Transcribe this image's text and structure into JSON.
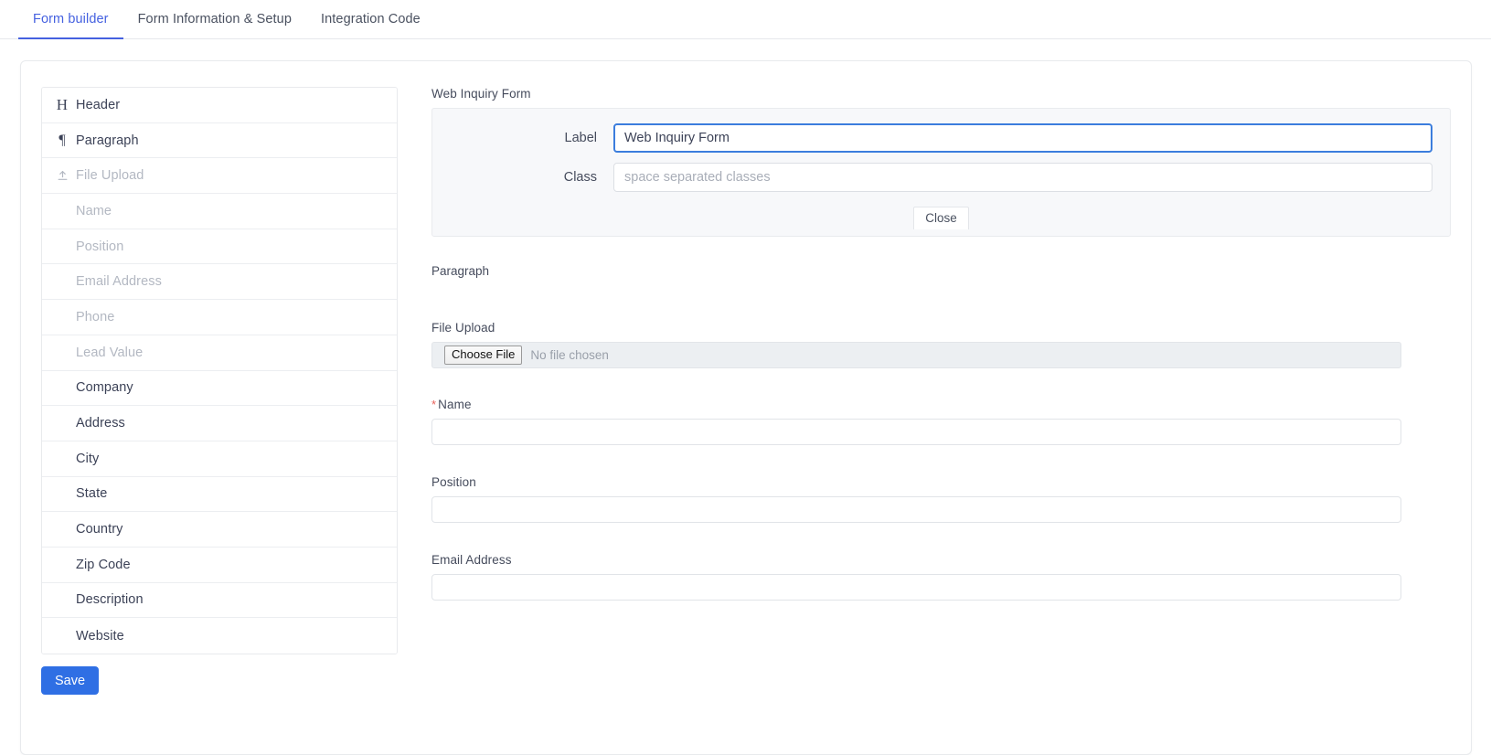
{
  "tabs": [
    {
      "label": "Form builder",
      "active": true
    },
    {
      "label": "Form Information & Setup",
      "active": false
    },
    {
      "label": "Integration Code",
      "active": false
    }
  ],
  "palette": {
    "items": [
      {
        "label": "Header",
        "icon": "heading-icon",
        "disabled": false
      },
      {
        "label": "Paragraph",
        "icon": "paragraph-icon",
        "disabled": false
      },
      {
        "label": "File Upload",
        "icon": "file-upload-icon",
        "disabled": true
      },
      {
        "label": "Name",
        "icon": "",
        "disabled": true
      },
      {
        "label": "Position",
        "icon": "",
        "disabled": true
      },
      {
        "label": "Email Address",
        "icon": "",
        "disabled": true
      },
      {
        "label": "Phone",
        "icon": "",
        "disabled": true
      },
      {
        "label": "Lead Value",
        "icon": "",
        "disabled": true
      },
      {
        "label": "Company",
        "icon": "",
        "disabled": false
      },
      {
        "label": "Address",
        "icon": "",
        "disabled": false
      },
      {
        "label": "City",
        "icon": "",
        "disabled": false
      },
      {
        "label": "State",
        "icon": "",
        "disabled": false
      },
      {
        "label": "Country",
        "icon": "",
        "disabled": false
      },
      {
        "label": "Zip Code",
        "icon": "",
        "disabled": false
      },
      {
        "label": "Description",
        "icon": "",
        "disabled": false
      },
      {
        "label": "Website",
        "icon": "",
        "disabled": false
      }
    ],
    "save_label": "Save"
  },
  "preview": {
    "header_field": {
      "title": "Web Inquiry Form",
      "editor": {
        "label_label": "Label",
        "label_value": "Web Inquiry Form",
        "class_label": "Class",
        "class_value": "",
        "class_placeholder": "space separated classes",
        "close_label": "Close"
      }
    },
    "paragraph_label": "Paragraph",
    "file_upload": {
      "label": "File Upload",
      "button_label": "Choose File",
      "status_text": "No file chosen"
    },
    "fields": [
      {
        "label": "Name",
        "required": true,
        "value": ""
      },
      {
        "label": "Position",
        "required": false,
        "value": ""
      },
      {
        "label": "Email Address",
        "required": false,
        "value": ""
      }
    ]
  },
  "colors": {
    "accent_blue": "#4561e0",
    "save_blue": "#2f6fe4",
    "focus_blue": "#3b7ddd",
    "required_red": "#e8605a",
    "panel_bg": "#f7f8fa",
    "border": "#e8eaed"
  }
}
